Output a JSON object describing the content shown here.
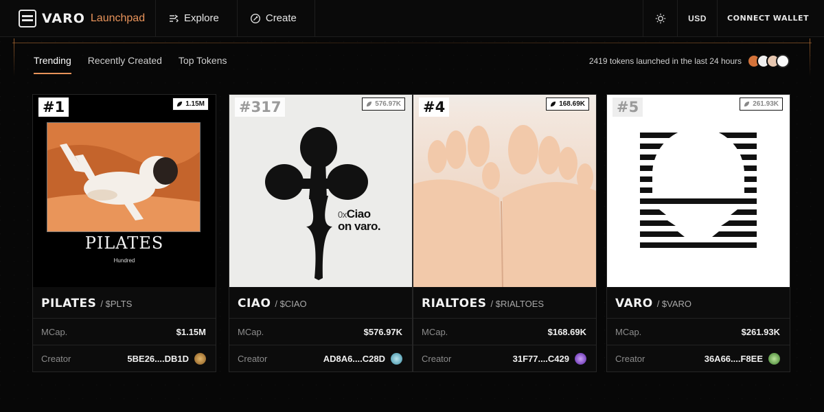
{
  "nav": {
    "brand": "VARO",
    "brand_sub": "Launchpad",
    "links": [
      {
        "label": "Explore",
        "icon": "explore-icon"
      },
      {
        "label": "Create",
        "icon": "create-icon"
      }
    ],
    "theme_icon": "sun-icon",
    "currency": "USD",
    "connect": "CONNECT WALLET"
  },
  "tabs": [
    {
      "label": "Trending",
      "active": true
    },
    {
      "label": "Recently Created",
      "active": false
    },
    {
      "label": "Top Tokens",
      "active": false
    }
  ],
  "stats_text": "2419 tokens launched in the last 24 hours",
  "colors": {
    "accent": "#e8935a",
    "bg": "#070707"
  },
  "cards": [
    {
      "rank": "#1",
      "badge": "1.15M",
      "name": "PILATES",
      "ticker": "/ $PLTS",
      "art_title": "PILATES",
      "art_sub": "Hundred",
      "mcap_label": "MCap.",
      "mcap": "$1.15M",
      "creator_label": "Creator",
      "creator": "5BE26....DB1D",
      "avatar_color": "#b07a2e"
    },
    {
      "rank": "#317",
      "badge": "576.97K",
      "name": "CIAO",
      "ticker": "/ $CIAO",
      "art_prefix": "0x",
      "art_line1": "Ciao",
      "art_line2": "on varo.",
      "mcap_label": "MCap.",
      "mcap": "$576.97K",
      "creator_label": "Creator",
      "creator": "AD8A6....C28D",
      "avatar_color": "#6fb8c8"
    },
    {
      "rank": "#4",
      "badge": "168.69K",
      "name": "RIALTOES",
      "ticker": "/ $RIALTOES",
      "mcap_label": "MCap.",
      "mcap": "$168.69K",
      "creator_label": "Creator",
      "creator": "31F77....C429",
      "avatar_color": "#8a4fd0"
    },
    {
      "rank": "#5",
      "badge": "261.93K",
      "name": "VARO",
      "ticker": "/ $VARO",
      "mcap_label": "MCap.",
      "mcap": "$261.93K",
      "creator_label": "Creator",
      "creator": "36A66....F8EE",
      "avatar_color": "#5aa04a"
    }
  ]
}
